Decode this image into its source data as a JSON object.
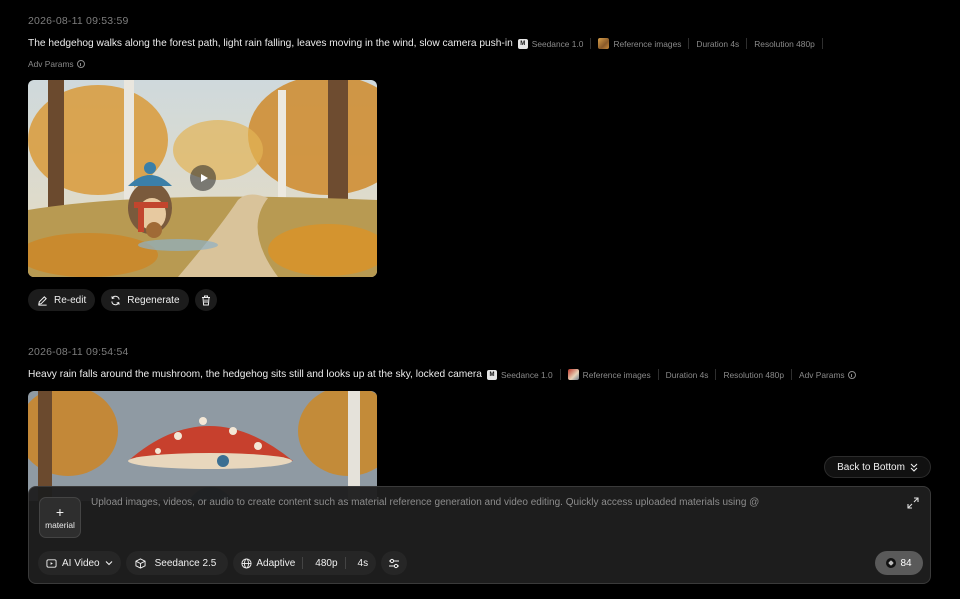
{
  "entries": [
    {
      "timestamp": "2026-08-11 09:53:59",
      "prompt": "The hedgehog walks along the forest path, light rain falling, leaves moving in the wind, slow camera push-in",
      "model_badge": "M",
      "model": "Seedance 1.0",
      "reference": "Reference images",
      "duration": "Duration 4s",
      "resolution": "Resolution 480p",
      "adv": "Adv Params"
    },
    {
      "timestamp": "2026-08-11 09:54:54",
      "prompt": "Heavy rain falls around the mushroom, the hedgehog sits still and looks up at the sky, locked camera",
      "model_badge": "M",
      "model": "Seedance 1.0",
      "reference": "Reference images",
      "duration": "Duration 4s",
      "resolution": "Resolution 480p",
      "adv": "Adv Params"
    }
  ],
  "actions": {
    "reedit": "Re-edit",
    "regenerate": "Regenerate"
  },
  "back_to_bottom": "Back to Bottom",
  "composer": {
    "material_plus": "+",
    "material_label": "material",
    "placeholder": "Upload images, videos, or audio to create content such as material reference generation and video editing. Quickly access uploaded materials using @",
    "mode": "AI Video",
    "model": "Seedance 2.5",
    "ratio": "Adaptive",
    "resolution": "480p",
    "duration": "4s",
    "credits": "84"
  },
  "icons": {
    "play": "play-icon",
    "edit": "pencil-icon",
    "regenerate": "refresh-icon",
    "delete": "trash-icon",
    "expand": "expand-icon",
    "settings": "sliders-icon"
  }
}
